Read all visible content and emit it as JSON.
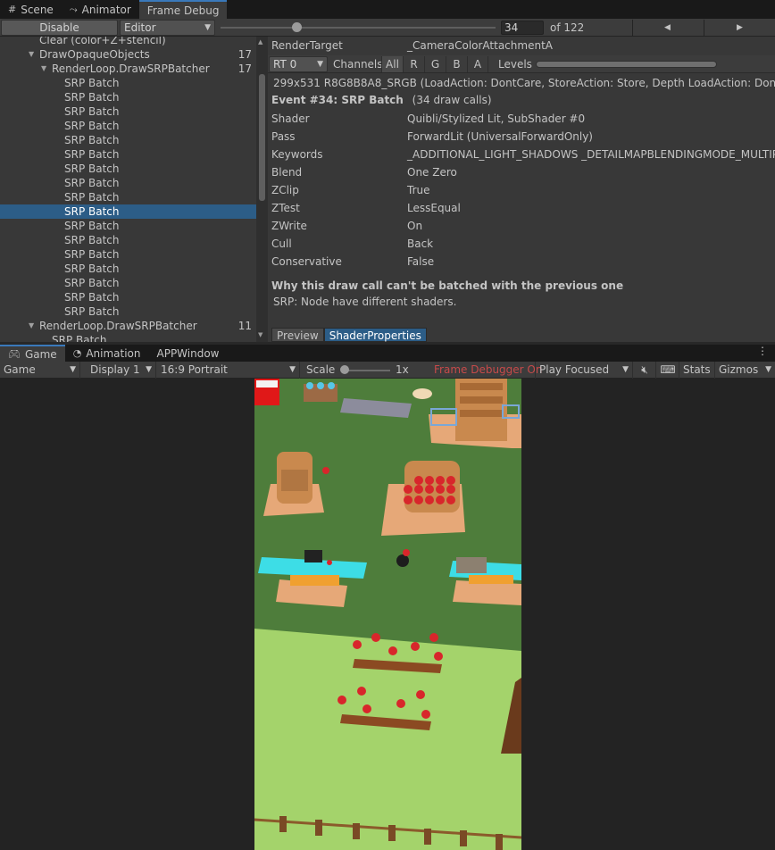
{
  "top_tabs": [
    {
      "label": "Scene",
      "icon": "grid-icon"
    },
    {
      "label": "Animator",
      "icon": "animator-icon"
    },
    {
      "label": "Frame Debug",
      "icon": ""
    }
  ],
  "frame_debug": {
    "disable_label": "Disable",
    "target_dropdown": "Editor",
    "event_index": "34",
    "event_total": "of 122"
  },
  "tree": {
    "rows": [
      {
        "label": "Clear (color+Z+stencil)",
        "count": ""
      },
      {
        "label": "DrawOpaqueObjects",
        "count": "17"
      },
      {
        "label": "RenderLoop.DrawSRPBatcher",
        "count": "17"
      },
      {
        "label": "SRP Batch",
        "count": ""
      },
      {
        "label": "SRP Batch",
        "count": ""
      },
      {
        "label": "SRP Batch",
        "count": ""
      },
      {
        "label": "SRP Batch",
        "count": ""
      },
      {
        "label": "SRP Batch",
        "count": ""
      },
      {
        "label": "SRP Batch",
        "count": ""
      },
      {
        "label": "SRP Batch",
        "count": ""
      },
      {
        "label": "SRP Batch",
        "count": ""
      },
      {
        "label": "SRP Batch",
        "count": ""
      },
      {
        "label": "SRP Batch",
        "count": ""
      },
      {
        "label": "SRP Batch",
        "count": ""
      },
      {
        "label": "SRP Batch",
        "count": ""
      },
      {
        "label": "SRP Batch",
        "count": ""
      },
      {
        "label": "SRP Batch",
        "count": ""
      },
      {
        "label": "SRP Batch",
        "count": ""
      },
      {
        "label": "SRP Batch",
        "count": ""
      },
      {
        "label": "SRP Batch",
        "count": ""
      },
      {
        "label": "RenderLoop.DrawSRPBatcher",
        "count": "11"
      },
      {
        "label": "SRP Batch",
        "count": ""
      }
    ]
  },
  "detail": {
    "render_target_key": "RenderTarget",
    "render_target_value": "_CameraColorAttachmentA",
    "rt_dropdown": "RT 0",
    "channels_label": "Channels",
    "channels": [
      "All",
      "R",
      "G",
      "B",
      "A"
    ],
    "levels_label": "Levels",
    "rt_info": "299x531 R8G8B8A8_SRGB (LoadAction: DontCare, StoreAction: Store, Depth LoadAction: DontCare",
    "event_title": "Event #34: SRP Batch",
    "event_calls": "(34 draw calls)",
    "properties": [
      {
        "key": "Shader",
        "value": "Quibli/Stylized Lit, SubShader #0"
      },
      {
        "key": "Pass",
        "value": "ForwardLit (UniversalForwardOnly)"
      },
      {
        "key": "Keywords",
        "value": "_ADDITIONAL_LIGHT_SHADOWS _DETAILMAPBLENDINGMODE_MULTIPLY"
      },
      {
        "key": "Blend",
        "value": "One Zero"
      },
      {
        "key": "ZClip",
        "value": "True"
      },
      {
        "key": "ZTest",
        "value": "LessEqual"
      },
      {
        "key": "ZWrite",
        "value": "On"
      },
      {
        "key": "Cull",
        "value": "Back"
      },
      {
        "key": "Conservative",
        "value": "False"
      }
    ],
    "batch_title": "Why this draw call can't be batched with the previous one",
    "batch_reason": "SRP: Node have different shaders.",
    "subtabs": [
      "Preview",
      "ShaderProperties"
    ]
  },
  "game_tabs": [
    {
      "label": "Game",
      "icon": "gamepad-icon"
    },
    {
      "label": "Animation",
      "icon": "clock-icon"
    },
    {
      "label": "APPWindow",
      "icon": ""
    }
  ],
  "game_toolbar": {
    "mode": "Game",
    "display": "Display 1",
    "aspect": "16:9 Portrait",
    "scale_label": "Scale",
    "scale_value": "1x",
    "frame_debugger_status": "Frame Debugger On",
    "play_mode": "Play Focused",
    "stats_label": "Stats",
    "gizmos_label": "Gizmos"
  },
  "colors": {
    "selection": "#2c5d87",
    "accent_tab": "#3a79bb",
    "warning_text": "#c64a4a",
    "grass_dark": "#4e7d3b",
    "grass_light": "#a4d36b",
    "soil": "#e6a878",
    "tomato": "#d8262b",
    "water": "#3ddde6"
  }
}
